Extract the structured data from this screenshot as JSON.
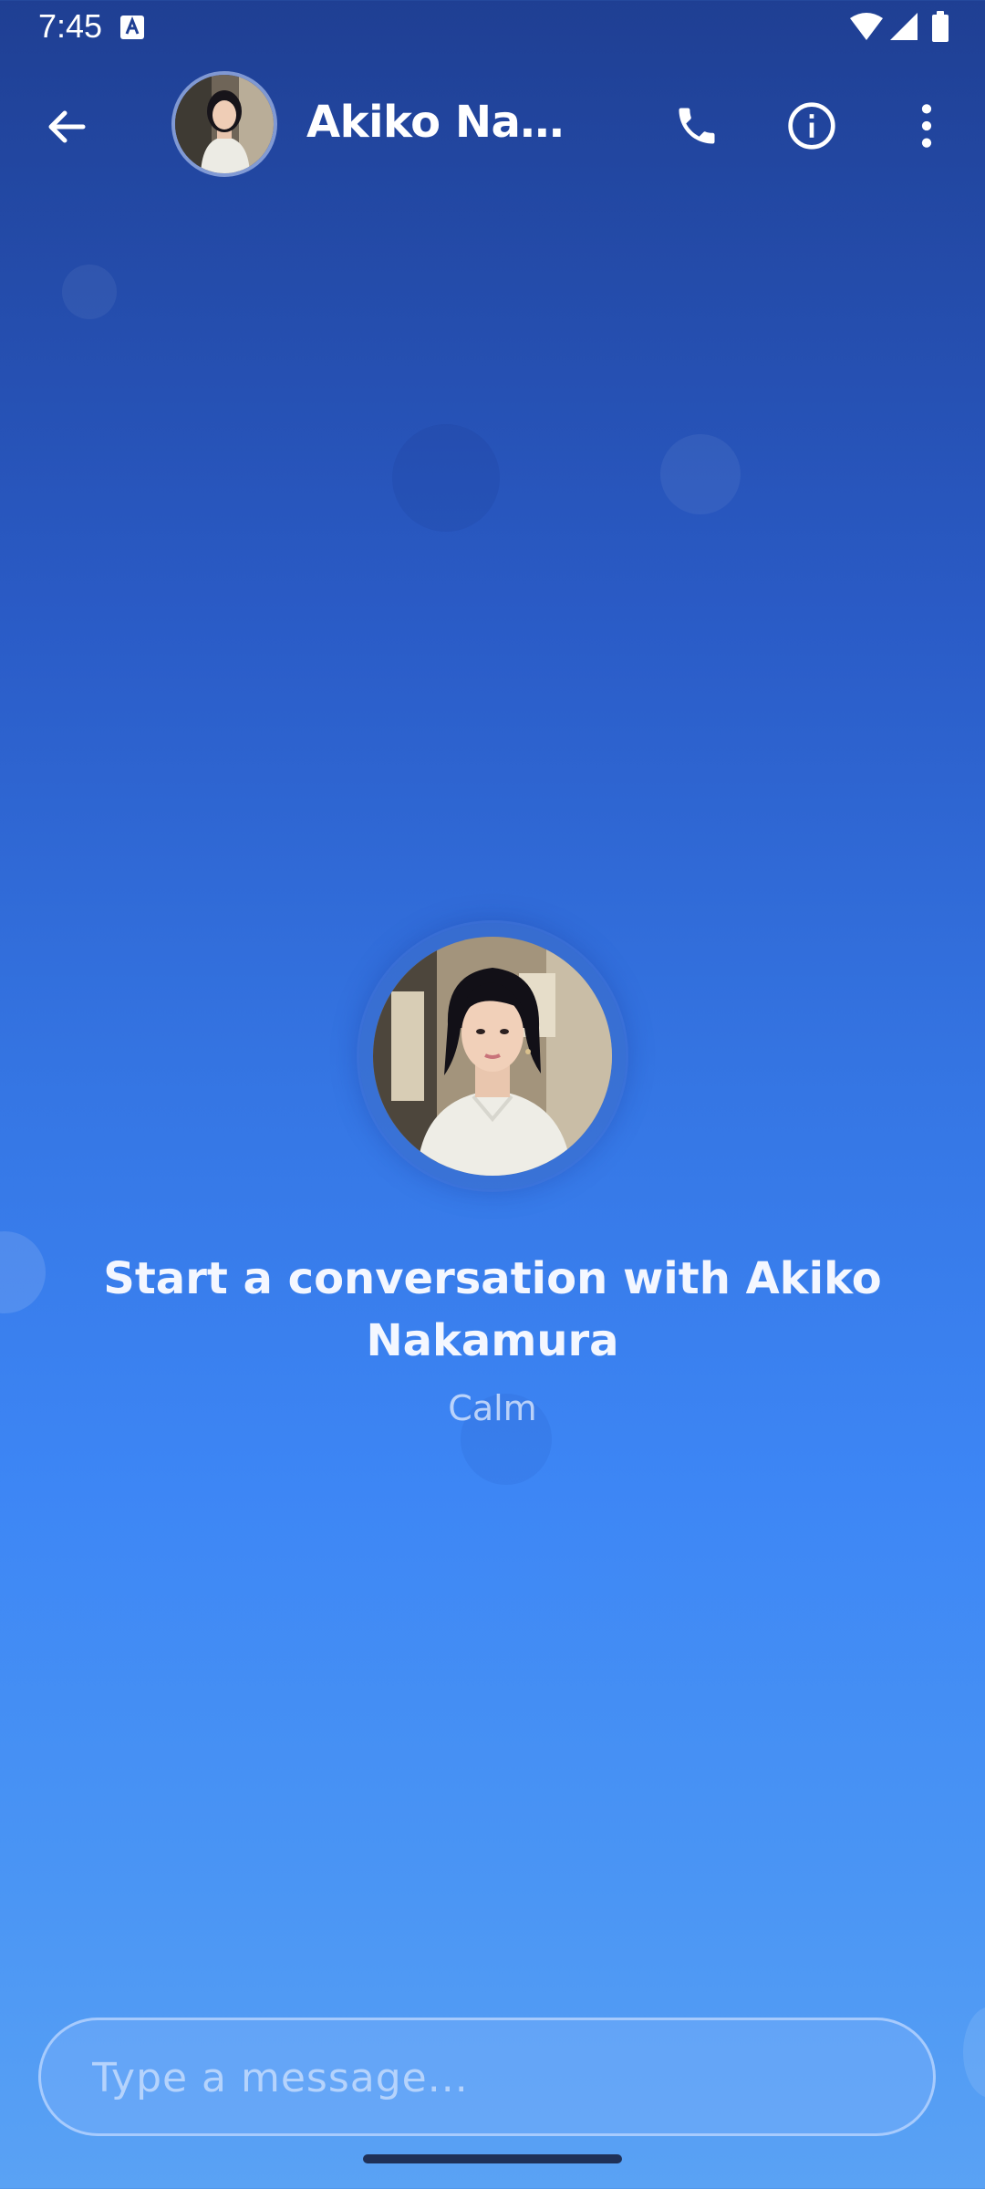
{
  "status_bar": {
    "time": "7:45",
    "icons": [
      "accessibility-a-icon",
      "wifi-icon",
      "cellular-signal-icon",
      "battery-icon"
    ]
  },
  "header": {
    "back_icon": "arrow-left-icon",
    "contact_name": "Akiko Nakamura",
    "call_icon": "phone-icon",
    "info_icon": "info-icon",
    "more_icon": "more-vertical-icon"
  },
  "empty_state": {
    "title": "Start a conversation with Akiko Nakamura",
    "subtitle": "Calm"
  },
  "composer": {
    "placeholder": "Type a message...",
    "value": ""
  },
  "colors": {
    "gradient_top": "#1f3f93",
    "gradient_bottom": "#5aa2f4",
    "text": "#ffffff"
  }
}
